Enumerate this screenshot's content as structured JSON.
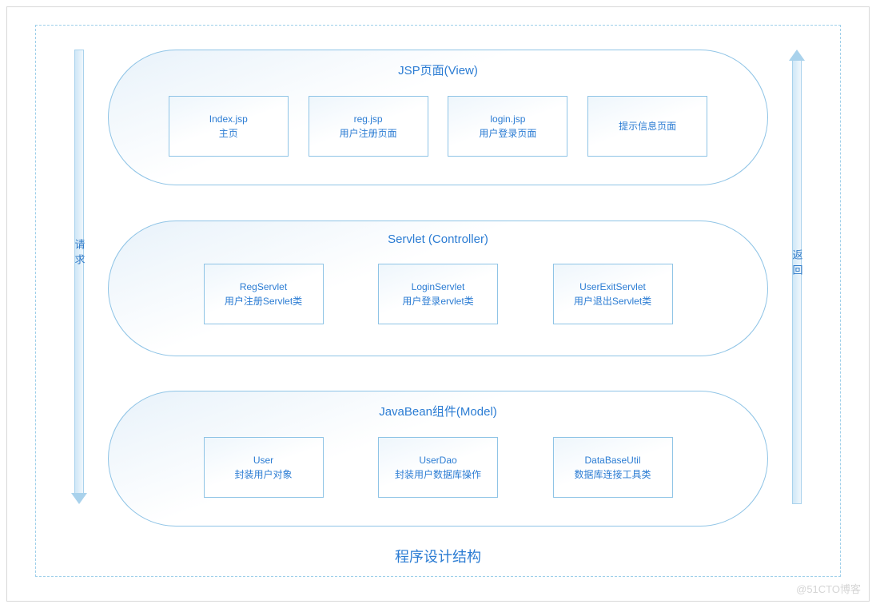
{
  "footerTitle": "程序设计结构",
  "watermark": "@51CTO博客",
  "arrows": {
    "leftLabel": "请求",
    "rightLabel": "返回"
  },
  "layers": [
    {
      "title": "JSP页面(View)",
      "boxes": [
        {
          "line1": "Index.jsp",
          "line2": "主页"
        },
        {
          "line1": "reg.jsp",
          "line2": "用户注册页面"
        },
        {
          "line1": "login.jsp",
          "line2": "用户登录页面"
        },
        {
          "line1": "提示信息页面",
          "line2": ""
        }
      ]
    },
    {
      "title": "Servlet (Controller)",
      "boxes": [
        {
          "line1": "RegServlet",
          "line2": "用户注册Servlet类"
        },
        {
          "line1": "LoginServlet",
          "line2": "用户登录ervlet类"
        },
        {
          "line1": "UserExitServlet",
          "line2": "用户退出Servlet类"
        }
      ]
    },
    {
      "title": "JavaBean组件(Model)",
      "boxes": [
        {
          "line1": "User",
          "line2": "封装用户对象"
        },
        {
          "line1": "UserDao",
          "line2": "封装用户数据库操作"
        },
        {
          "line1": "DataBaseUtil",
          "line2": "数据库连接工具类"
        }
      ]
    }
  ]
}
